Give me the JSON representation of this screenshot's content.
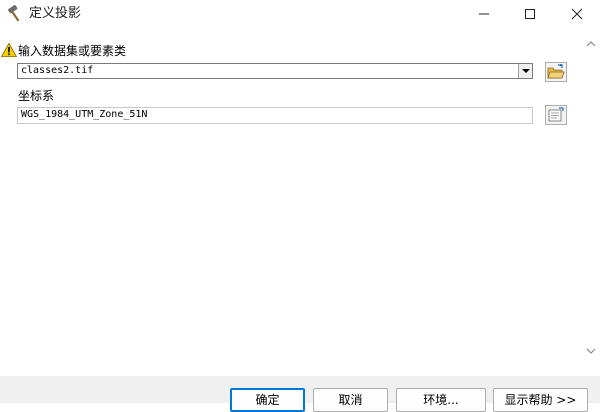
{
  "window": {
    "title": "定义投影",
    "title_icon": "hammer-icon",
    "controls": {
      "minimize_icon": "minimize-icon",
      "maximize_icon": "maximize-icon",
      "close_icon": "close-icon"
    }
  },
  "form": {
    "input_label": "输入数据集或要素类",
    "input_value": "classes2.tif",
    "input_warning_icon": "warning-icon",
    "coord_label": "坐标系",
    "coord_value": "WGS_1984_UTM_Zone_51N"
  },
  "buttons": {
    "ok": "确定",
    "cancel": "取消",
    "environments": "环境...",
    "show_help": "显示帮助 >>"
  },
  "colors": {
    "accent": "#0078d7",
    "warning": "#f5d000",
    "folder": "#e8b84a"
  }
}
